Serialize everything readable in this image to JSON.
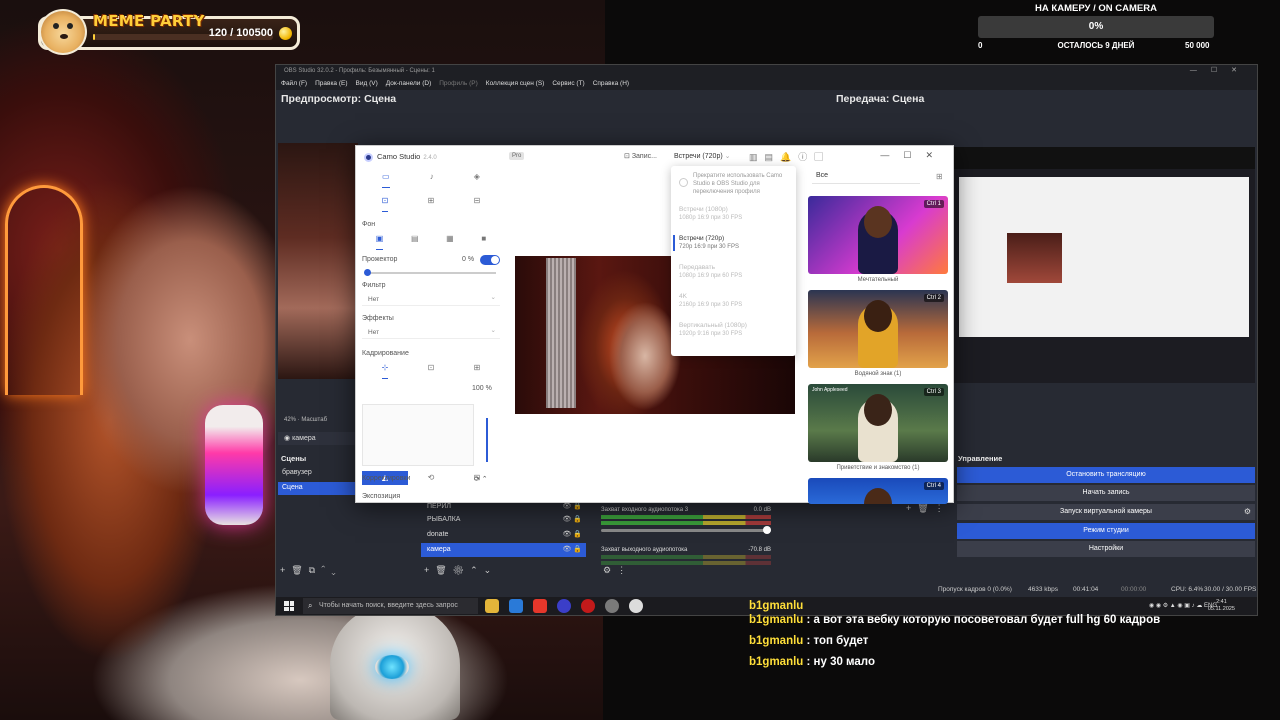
{
  "meme_widget": {
    "title": "MEME PARTY",
    "score": "120 / 100500",
    "progress": 0.0012
  },
  "goal_widget": {
    "title": "НА КАМЕРУ / ON CAMERA",
    "percent": "0%",
    "progress": 0,
    "min": "0",
    "remaining": "ОСТАЛОСЬ 9 ДНЕЙ",
    "max": "50 000"
  },
  "obs": {
    "title": "OBS Studio 32.0.2 - Профиль: Безымянный - Сцены: 1",
    "menu": [
      "Файл (F)",
      "Правка (E)",
      "Вид (V)",
      "Док-панели (D)",
      "Профиль (P)",
      "Коллекция сцен (S)",
      "Сервис (T)",
      "Справка (H)"
    ],
    "preview_label": "Предпросмотр: Сцена",
    "program_label": "Передача: Сцена",
    "zoom": "42%  ·  Масштаб",
    "camera_source": "камера",
    "scenes_heading": "Сцены",
    "scenes": [
      {
        "name": "бравузер",
        "active": false
      },
      {
        "name": "Сцена",
        "active": true
      }
    ],
    "sources": [
      {
        "name": "ПЕРИЛ",
        "active": false
      },
      {
        "name": "РЫБАЛКА",
        "active": false
      },
      {
        "name": "donate",
        "active": false
      },
      {
        "name": "камера",
        "active": true
      }
    ],
    "mixer": [
      {
        "name": "Захват входного аудиопотока 3",
        "db": "0.0 dB",
        "live": true
      },
      {
        "name": "Захват выходного аудиопотока",
        "db": "-70.8 dB",
        "live": false
      }
    ],
    "controls_heading": "Управление",
    "controls": [
      {
        "label": "Остановить трансляцию",
        "accent": true
      },
      {
        "label": "Начать запись",
        "accent": false
      },
      {
        "label": "Запуск виртуальной камеры",
        "accent": false
      },
      {
        "label": "Режим студии",
        "accent": true
      },
      {
        "label": "Настройки",
        "accent": false
      }
    ],
    "status": {
      "dropped": "Пропуск кадров 0 (0.0%)",
      "bitrate": "4633 kbps",
      "live_time": "00:41:04",
      "rec_time": "00:00:00",
      "cpu": "CPU: 6.4%",
      "fps": "30.00 / 30.00 FPS"
    }
  },
  "taskbar": {
    "search_placeholder": "Чтобы начать поиск, введите здесь запрос",
    "lang": "ENG",
    "time": "2:41",
    "date": "05.11.2025"
  },
  "camo": {
    "title": "Camo Studio",
    "version": "2.4.0",
    "pro_badge": "Pro",
    "record_label": "Запис...",
    "resolution": "Встречи (720p)",
    "bg_label": "Фон",
    "spotlight_label": "Прожектор",
    "spotlight_value": "0 %",
    "filter_label": "Фильтр",
    "filter_value": "Нет",
    "effects_label": "Эффекты",
    "effects_value": "Нет",
    "crop_label": "Кадрирование",
    "crop_zoom": "100 %",
    "adjust_label": "Корректировки",
    "exposure_label": "Экспозиция",
    "res_notice": "Прекратите использовать Camo Studio в OBS Studio для переключения профиля",
    "res_options": [
      {
        "name": "Встречи (1080p)",
        "detail": "1080p 16:9 при 30 FPS",
        "selected": false
      },
      {
        "name": "Встречи (720p)",
        "detail": "720p 16:9 при 30 FPS",
        "selected": true
      },
      {
        "name": "Передавать",
        "detail": "1080p 16:9 при 60 FPS",
        "selected": false
      },
      {
        "name": "4K",
        "detail": "2160p 16:9 при 30 FPS",
        "selected": false
      },
      {
        "name": "Вертикальный (1080p)",
        "detail": "1920p 9:16 при 30 FPS",
        "selected": false
      }
    ],
    "preset_filter": "Все",
    "presets": [
      {
        "key": "Ctrl 1",
        "label": "Мечтательный"
      },
      {
        "key": "Ctrl 2",
        "label": "Водяной знак (1)"
      },
      {
        "key": "Ctrl 3",
        "label": "Приветствие и знакомство (1)"
      },
      {
        "key": "Ctrl 4",
        "label": ""
      }
    ],
    "preset3_name": "John Appleseed"
  },
  "chat": [
    {
      "user": "b1gmanlu",
      "text": " : а вот эта вебку которую посоветовал будет full hg 60 кадров"
    },
    {
      "user": "b1gmanlu",
      "text": " : топ будет"
    },
    {
      "user": "b1gmanlu",
      "text": " : ну 30 мало"
    }
  ],
  "colors": {
    "accent": "#2c5bd6",
    "chat_user": "#ffdf3a",
    "meme_gold": "#ffcf3a"
  }
}
